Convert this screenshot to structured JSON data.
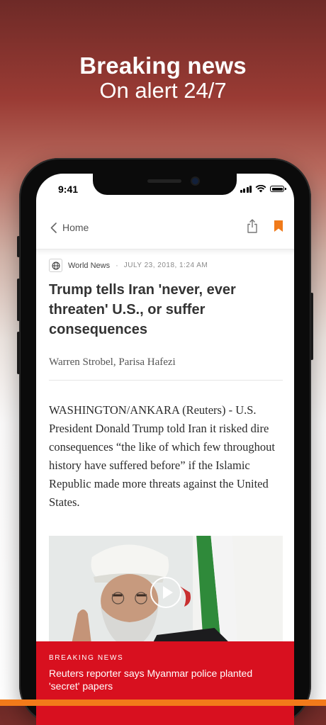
{
  "promo": {
    "title": "Breaking news",
    "subtitle": "On alert 24/7"
  },
  "status_bar": {
    "time": "9:41"
  },
  "navbar": {
    "back_label": "Home",
    "share_icon": "share-icon",
    "bookmark_icon": "bookmark-icon",
    "accent_color": "#f07a1a"
  },
  "article": {
    "section": "World News",
    "separator": "·",
    "date": "JULY 23, 2018, 1:24 AM",
    "headline": "Trump tells Iran 'never, ever threaten' U.S., or suffer consequences",
    "authors": "Warren Strobel, Parisa Hafezi",
    "body": "WASHINGTON/ANKARA (Reuters) - U.S. President Donald Trump told Iran it risked dire consequences “the like of which few throughout history have suffered before” if the Islamic Republic made more threats against the United States."
  },
  "breaking": {
    "label": "BREAKING NEWS",
    "text": "Reuters reporter says Myanmar police planted 'secret' papers",
    "color": "#d8101f"
  }
}
